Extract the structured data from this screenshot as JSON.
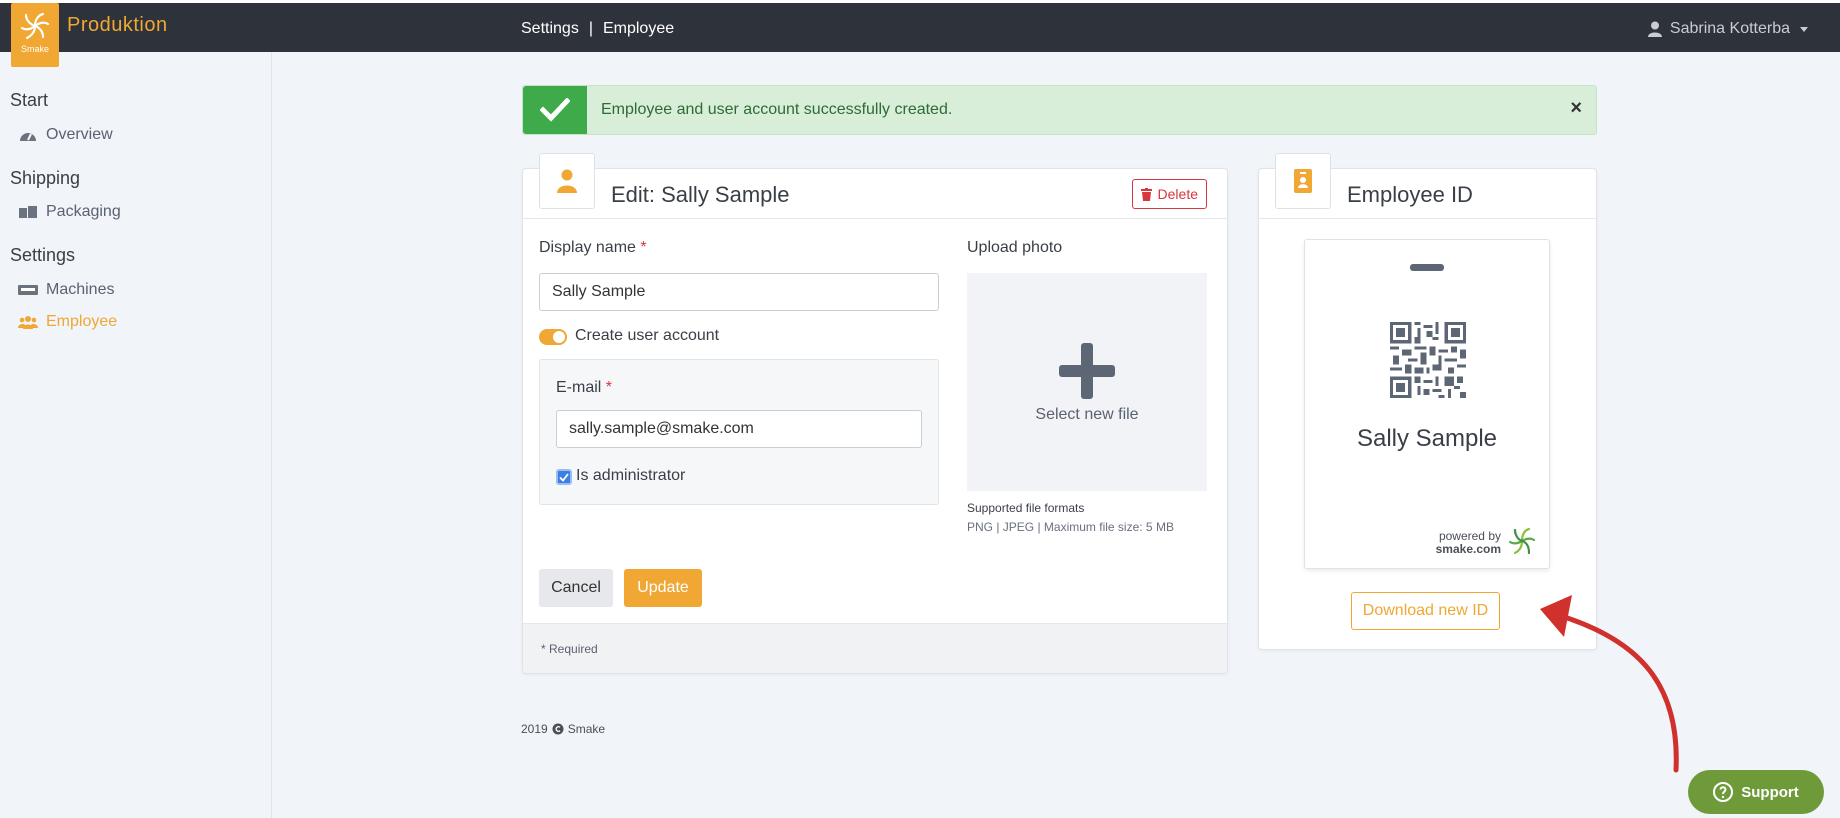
{
  "app": {
    "brand": "Produktion",
    "logo_text": "Smake"
  },
  "breadcrumb": {
    "items": [
      "Settings",
      "Employee"
    ],
    "separator": "|"
  },
  "user": {
    "name": "Sabrina Kotterba"
  },
  "sidebar": {
    "sections": [
      {
        "title": "Start",
        "items": [
          {
            "label": "Overview",
            "icon": "dashboard-icon"
          }
        ]
      },
      {
        "title": "Shipping",
        "items": [
          {
            "label": "Packaging",
            "icon": "boxes-icon"
          }
        ]
      },
      {
        "title": "Settings",
        "items": [
          {
            "label": "Machines",
            "icon": "machine-icon"
          },
          {
            "label": "Employee",
            "icon": "users-icon",
            "active": true
          }
        ]
      }
    ]
  },
  "alert": {
    "message": "Employee and user account successfully created.",
    "close": "×"
  },
  "edit": {
    "title": "Edit: Sally Sample",
    "delete_label": "Delete",
    "display_name_label": "Display name",
    "display_name_value": "Sally Sample",
    "required_mark": "*",
    "create_account_label": "Create user account",
    "email_label": "E-mail",
    "email_value": "sally.sample@smake.com",
    "admin_label": "Is administrator",
    "upload_label": "Upload photo",
    "select_file": "Select new file",
    "formats_title": "Supported file formats",
    "formats_text": "PNG | JPEG | Maximum file size: 5 MB",
    "cancel_label": "Cancel",
    "update_label": "Update",
    "required_note": "* Required"
  },
  "id_card": {
    "title": "Employee ID",
    "name": "Sally Sample",
    "powered_by": "powered by",
    "powered_site": "smake.com",
    "download_label": "Download new ID"
  },
  "footer": {
    "copyright": "2019",
    "company": "Smake"
  },
  "support": {
    "label": "Support"
  },
  "colors": {
    "accent": "#f0a733",
    "topbar": "#2e323a",
    "success": "#3faa4a",
    "danger": "#d9363e",
    "support": "#6f9a3a",
    "annotation_arrow": "#d0312d"
  }
}
